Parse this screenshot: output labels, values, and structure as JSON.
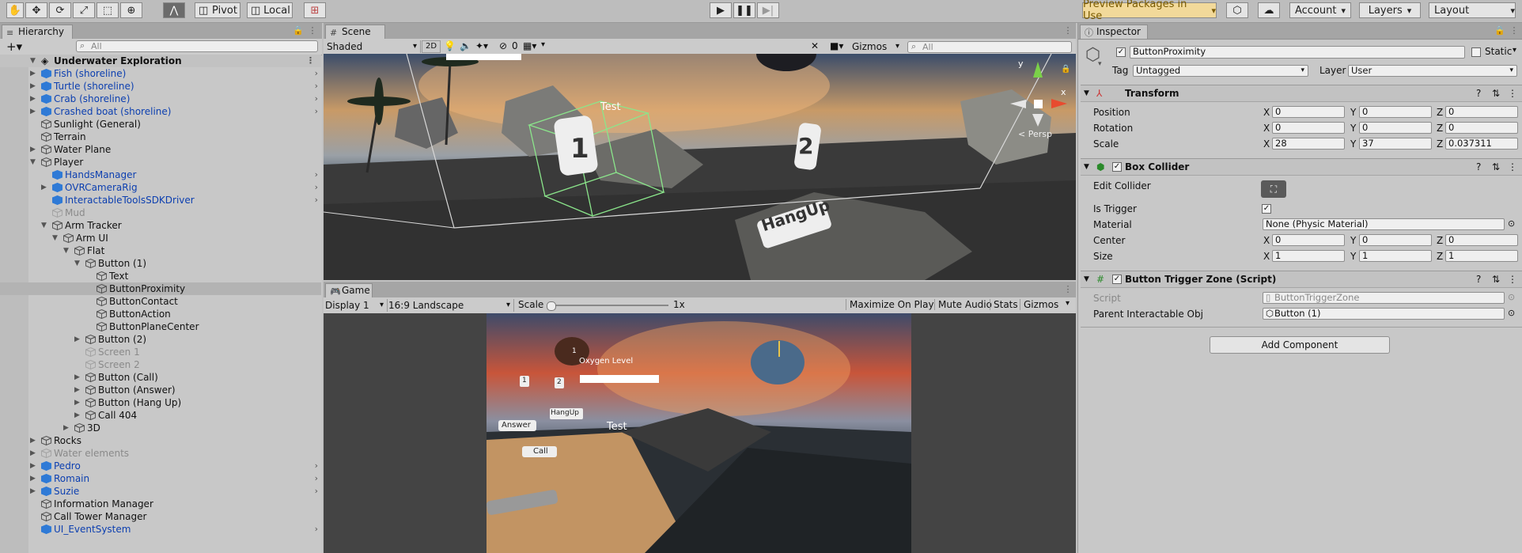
{
  "toolbar": {
    "pivot_label": "Pivot",
    "local_label": "Local",
    "preview_packages_label": "Preview Packages in Use",
    "account_label": "Account",
    "layers_label": "Layers",
    "layout_label": "Layout"
  },
  "hierarchy": {
    "tab_label": "Hierarchy",
    "search_placeholder": "All",
    "scene_name": "Underwater Exploration",
    "items": [
      {
        "label": "Fish (shoreline)"
      },
      {
        "label": "Turtle (shoreline)"
      },
      {
        "label": "Crab (shoreline)"
      },
      {
        "label": "Crashed boat (shoreline)"
      },
      {
        "label": "Sunlight (General)"
      },
      {
        "label": "Terrain"
      },
      {
        "label": "Water Plane"
      },
      {
        "label": "Player"
      },
      {
        "label": "HandsManager"
      },
      {
        "label": "OVRCameraRig"
      },
      {
        "label": "InteractableToolsSDKDriver"
      },
      {
        "label": "Mud"
      },
      {
        "label": "Arm Tracker"
      },
      {
        "label": "Arm UI"
      },
      {
        "label": "Flat"
      },
      {
        "label": "Button (1)"
      },
      {
        "label": "Text"
      },
      {
        "label": "ButtonProximity"
      },
      {
        "label": "ButtonContact"
      },
      {
        "label": "ButtonAction"
      },
      {
        "label": "ButtonPlaneCenter"
      },
      {
        "label": "Button (2)"
      },
      {
        "label": "Screen 1"
      },
      {
        "label": "Screen 2"
      },
      {
        "label": "Button (Call)"
      },
      {
        "label": "Button (Answer)"
      },
      {
        "label": "Button (Hang Up)"
      },
      {
        "label": "Call 404"
      },
      {
        "label": "3D"
      },
      {
        "label": "Rocks"
      },
      {
        "label": "Water elements"
      },
      {
        "label": "Pedro"
      },
      {
        "label": "Romain"
      },
      {
        "label": "Suzie"
      },
      {
        "label": "Information Manager"
      },
      {
        "label": "Call Tower Manager"
      },
      {
        "label": "UI_EventSystem"
      }
    ]
  },
  "scene": {
    "tab_label": "Scene",
    "shading_mode": "Shaded",
    "mode_2d": "2D",
    "hidden_count": "0",
    "gizmos_label": "Gizmos",
    "search_placeholder": "All",
    "label_test": "Test",
    "label_1": "1",
    "label_2": "2",
    "label_hangup": "HangUp",
    "persp_label": "< Persp",
    "axis_x": "x",
    "axis_y": "y"
  },
  "game": {
    "tab_label": "Game",
    "display": "Display 1",
    "aspect": "16:9 Landscape",
    "scale_label": "Scale",
    "scale_value": 0.0,
    "scale_text": "1x",
    "maximize_label": "Maximize On Play",
    "mute_label": "Mute Audio",
    "stats_label": "Stats",
    "gizmos_label": "Gizmos",
    "oxygen_label": "Oxygen Level",
    "btn_1": "1",
    "btn_2": "2",
    "hangup": "HangUp",
    "answer": "Answer",
    "call": "Call",
    "test": "Test"
  },
  "inspector": {
    "tab_label": "Inspector",
    "object_name": "ButtonProximity",
    "static_label": "Static",
    "tag_label": "Tag",
    "tag_value": "Untagged",
    "layer_label": "Layer",
    "layer_value": "User",
    "transform": {
      "title": "Transform",
      "position_label": "Position",
      "rotation_label": "Rotation",
      "scale_label": "Scale",
      "position": {
        "x": "0",
        "y": "0",
        "z": "0"
      },
      "rotation": {
        "x": "0",
        "y": "0",
        "z": "0"
      },
      "scale": {
        "x": "28",
        "y": "37",
        "z": "0.037311"
      }
    },
    "box_collider": {
      "title": "Box Collider",
      "edit_label": "Edit Collider",
      "trigger_label": "Is Trigger",
      "material_label": "Material",
      "material_value": "None (Physic Material)",
      "center_label": "Center",
      "size_label": "Size",
      "center": {
        "x": "0",
        "y": "0",
        "z": "0"
      },
      "size": {
        "x": "1",
        "y": "1",
        "z": "1"
      }
    },
    "script_comp": {
      "title": "Button Trigger Zone (Script)",
      "script_label": "Script",
      "script_value": "ButtonTriggerZone",
      "parent_label": "Parent Interactable Obj",
      "parent_value": "Button (1)"
    },
    "add_component": "Add Component",
    "axis_x": "X",
    "axis_y": "Y",
    "axis_z": "Z"
  }
}
